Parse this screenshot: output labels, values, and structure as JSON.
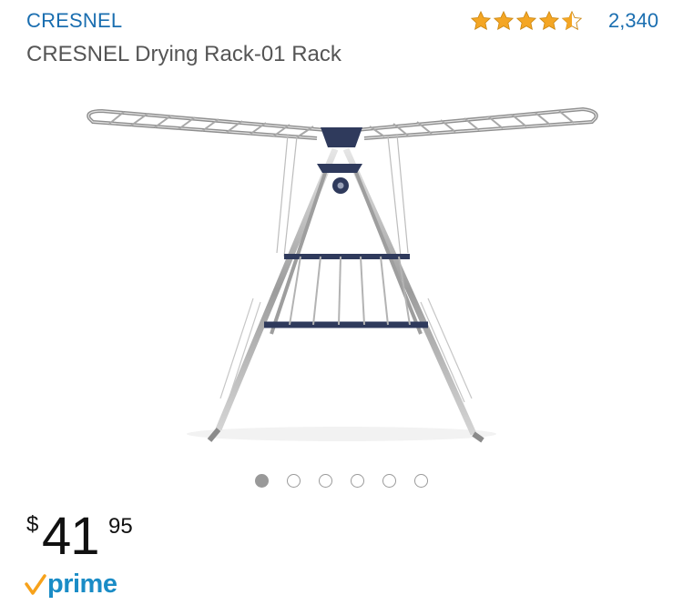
{
  "product": {
    "brand": "CRESNEL",
    "title": "CRESNEL Drying Rack-01 Rack"
  },
  "rating": {
    "stars": 4.5,
    "max_stars": 5,
    "review_count": "2,340",
    "star_color": "#f4a624"
  },
  "image": {
    "icon": "drying-rack-image",
    "carousel_count": 6,
    "carousel_active": 0
  },
  "price": {
    "currency": "$",
    "whole": "41",
    "fraction": "95"
  },
  "badge": {
    "prime_label": "prime",
    "prime_color": "#1a8cc6",
    "check_color": "#f7a21b"
  },
  "colors": {
    "link": "#1a6eb0",
    "title": "#555555"
  }
}
